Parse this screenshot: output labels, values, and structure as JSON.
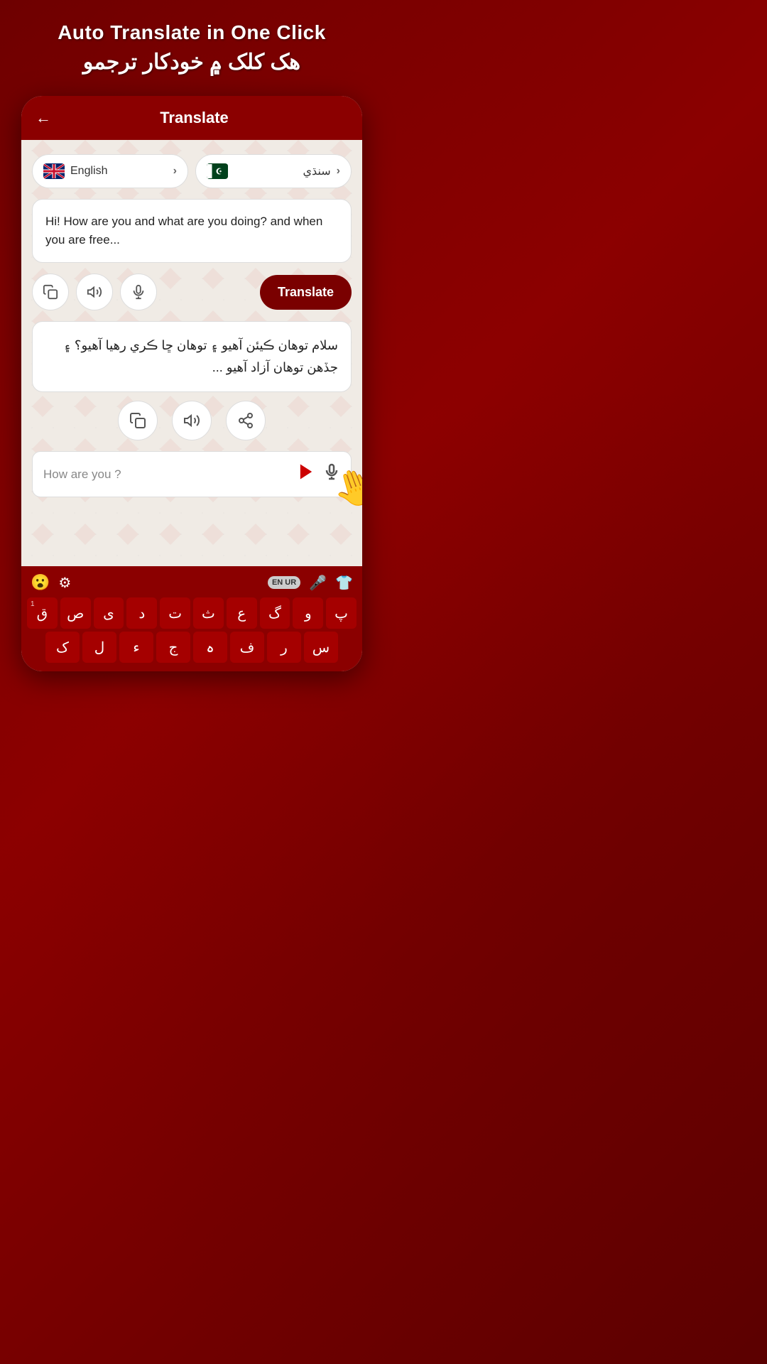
{
  "header": {
    "title_en": "Auto Translate in One Click",
    "title_ur": "هک کلک ۾ خودکار ترجمو"
  },
  "app_bar": {
    "back_label": "←",
    "title": "Translate"
  },
  "language_selector": {
    "source": {
      "flag": "uk",
      "name": "English",
      "arrow": "›"
    },
    "target": {
      "flag": "pk",
      "name": "سنڌي",
      "arrow": "›"
    }
  },
  "input_text": "Hi! How are you and what are you doing? and when you are free...",
  "controls": {
    "copy_label": "⧉",
    "volume_label": "🔊",
    "mic_label": "🎤",
    "translate_label": "Translate"
  },
  "output_text": "سلام توهان ڪيئن آهيو ۽ توهان ڇا ڪري رهيا آهيو؟ ۽ جڏهن توهان آزاد آهيو ...",
  "output_controls": {
    "copy_label": "⧉",
    "volume_label": "🔊",
    "share_label": "⬆"
  },
  "bottom_input": {
    "placeholder": "How are you ?",
    "send_icon": "▶",
    "mic_icon": "🎤"
  },
  "keyboard": {
    "top_left": {
      "emoji": "😮",
      "settings": "⚙"
    },
    "top_right": {
      "lang_toggle": "EN UR",
      "mic": "🎤",
      "shirt": "👕"
    },
    "row1": [
      "پ",
      "و",
      "گ",
      "ع",
      "ث",
      "ت",
      "د",
      "ی",
      "ص",
      "ق"
    ],
    "row1_super": [
      "",
      "",
      "",
      "",
      "",
      "",
      "",
      "",
      "",
      "1"
    ],
    "row2": [
      "ک",
      "ل",
      "ء",
      "ج",
      "ہ",
      "ف",
      "ر",
      "س"
    ]
  }
}
